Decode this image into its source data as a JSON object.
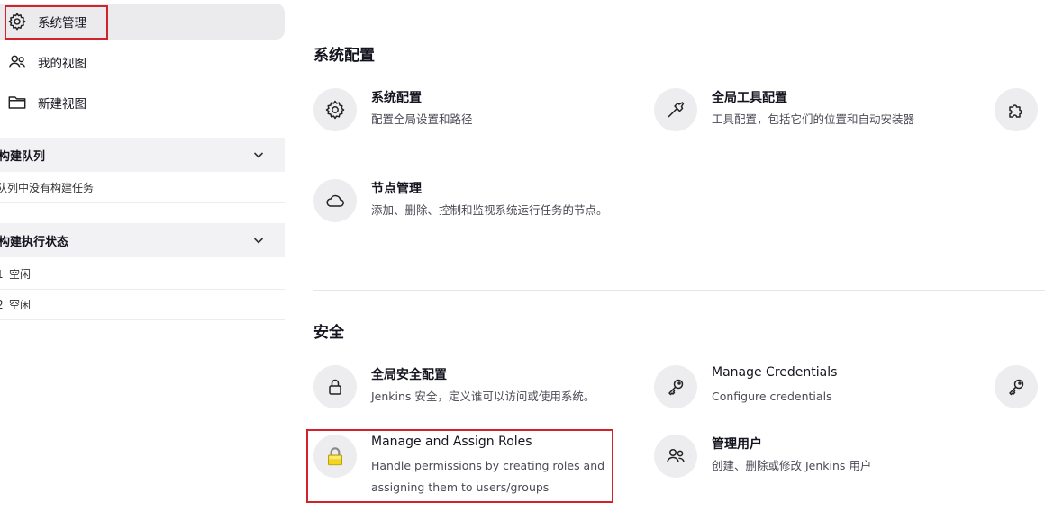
{
  "sidebar": {
    "nav": [
      {
        "label": "系统管理",
        "icon": "gear-icon",
        "active": true
      },
      {
        "label": "我的视图",
        "icon": "people-icon",
        "active": false
      },
      {
        "label": "新建视图",
        "icon": "folder-icon",
        "active": false
      }
    ],
    "build_queue": {
      "title": "构建队列",
      "empty_text": "队列中没有构建任务"
    },
    "executor_status": {
      "title": "构建执行状态",
      "executors": [
        {
          "num": "1",
          "status": "空闲"
        },
        {
          "num": "2",
          "status": "空闲"
        }
      ]
    }
  },
  "main": {
    "sections": [
      {
        "title": "系统配置",
        "items": [
          {
            "title": "系统配置",
            "desc": "配置全局设置和路径",
            "icon": "gear-icon"
          },
          {
            "title": "全局工具配置",
            "desc": "工具配置，包括它们的位置和自动安装器",
            "icon": "hammer-icon"
          },
          {
            "title": "",
            "desc": "",
            "icon": "puzzle-icon"
          },
          {
            "title": "节点管理",
            "desc": "添加、删除、控制和监视系统运行任务的节点。",
            "icon": "cloud-icon"
          }
        ]
      },
      {
        "title": "安全",
        "items": [
          {
            "title": "全局安全配置",
            "desc": "Jenkins 安全，定义谁可以访问或使用系统。",
            "icon": "lock-icon"
          },
          {
            "title": "Manage Credentials",
            "desc": "Configure credentials",
            "icon": "key-icon"
          },
          {
            "title": "",
            "desc": "",
            "icon": "key-icon"
          },
          {
            "title": "Manage and Assign Roles",
            "desc": "Handle permissions by creating roles and assigning them to users/groups",
            "icon": "yellow-padlock-icon"
          },
          {
            "title": "管理用户",
            "desc": "创建、删除或修改 Jenkins 用户",
            "icon": "users-icon"
          }
        ]
      }
    ]
  },
  "colors": {
    "highlight": "#d2232a",
    "active_bg": "#ebebed",
    "icon_circle": "#ededf0",
    "padlock": "#f2d51f"
  }
}
